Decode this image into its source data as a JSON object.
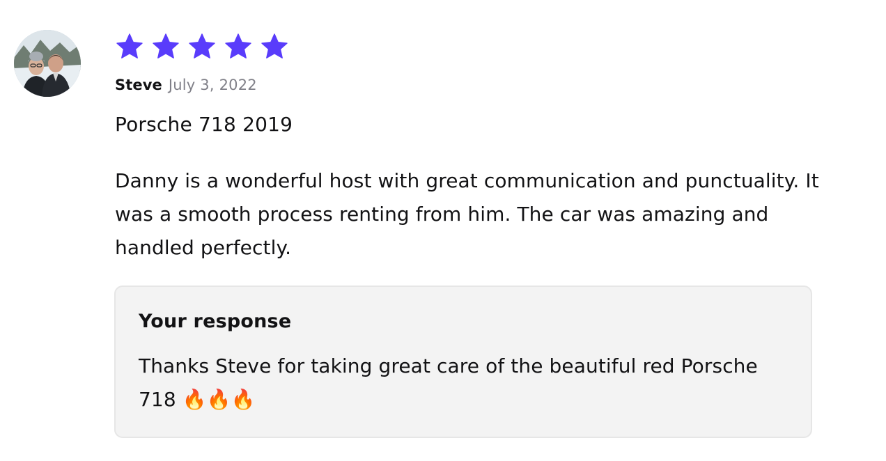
{
  "review": {
    "rating": 5,
    "rating_max": 5,
    "star_color": "#593cfb",
    "star_icon": "star-icon",
    "avatar_icon": "reviewer-avatar",
    "author": "Steve",
    "date": "July 3, 2022",
    "vehicle": "Porsche 718 2019",
    "text": "Danny is a wonderful host with great communication and punctuality. It was a smooth process renting from him. The car was amazing and handled perfectly."
  },
  "response": {
    "title": "Your response",
    "text": "Thanks Steve for taking great care of the beautiful red Porsche 718 🔥🔥🔥"
  }
}
